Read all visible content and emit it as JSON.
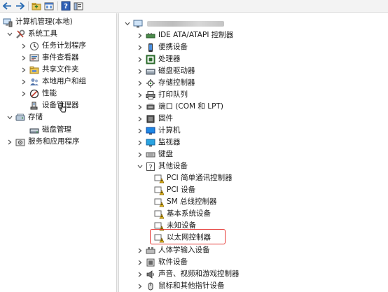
{
  "toolbar": {
    "buttons": [
      {
        "name": "back-arrow-icon"
      },
      {
        "name": "forward-arrow-icon"
      },
      {
        "name": "folder-up-icon"
      },
      {
        "name": "properties-icon"
      },
      {
        "name": "help-icon"
      },
      {
        "name": "show-hide-icon"
      }
    ]
  },
  "left_tree": {
    "root": "计算机管理(本地)",
    "system_tools": "系统工具",
    "task_scheduler": "任务计划程序",
    "event_viewer": "事件查看器",
    "shared_folders": "共享文件夹",
    "local_users": "本地用户和组",
    "performance": "性能",
    "device_manager": "设备管理器",
    "storage": "存储",
    "disk_management": "磁盘管理",
    "services": "服务和应用程序"
  },
  "device_tree": {
    "ide": "IDE ATA/ATAPI 控制器",
    "portable": "便携设备",
    "processor": "处理器",
    "disk_drives": "磁盘驱动器",
    "storage_ctrl": "存储控制器",
    "print_queue": "打印队列",
    "ports": "端口 (COM 和 LPT)",
    "firmware": "固件",
    "computer": "计算机",
    "monitors": "监视器",
    "keyboard": "键盘",
    "other_devices": "其他设备",
    "pci_comm": "PCI 简单通讯控制器",
    "pci_device": "PCI 设备",
    "sm_bus": "SM 总线控制器",
    "base_system": "基本系统设备",
    "unknown": "未知设备",
    "ethernet": "以太网控制器",
    "hid": "人体学输入设备",
    "software": "软件设备",
    "sound": "声音、视频和游戏控制器",
    "mouse": "鼠标和其他指针设备"
  },
  "colors": {
    "highlight_border": "#e53935",
    "warning_yellow": "#f5c518"
  }
}
